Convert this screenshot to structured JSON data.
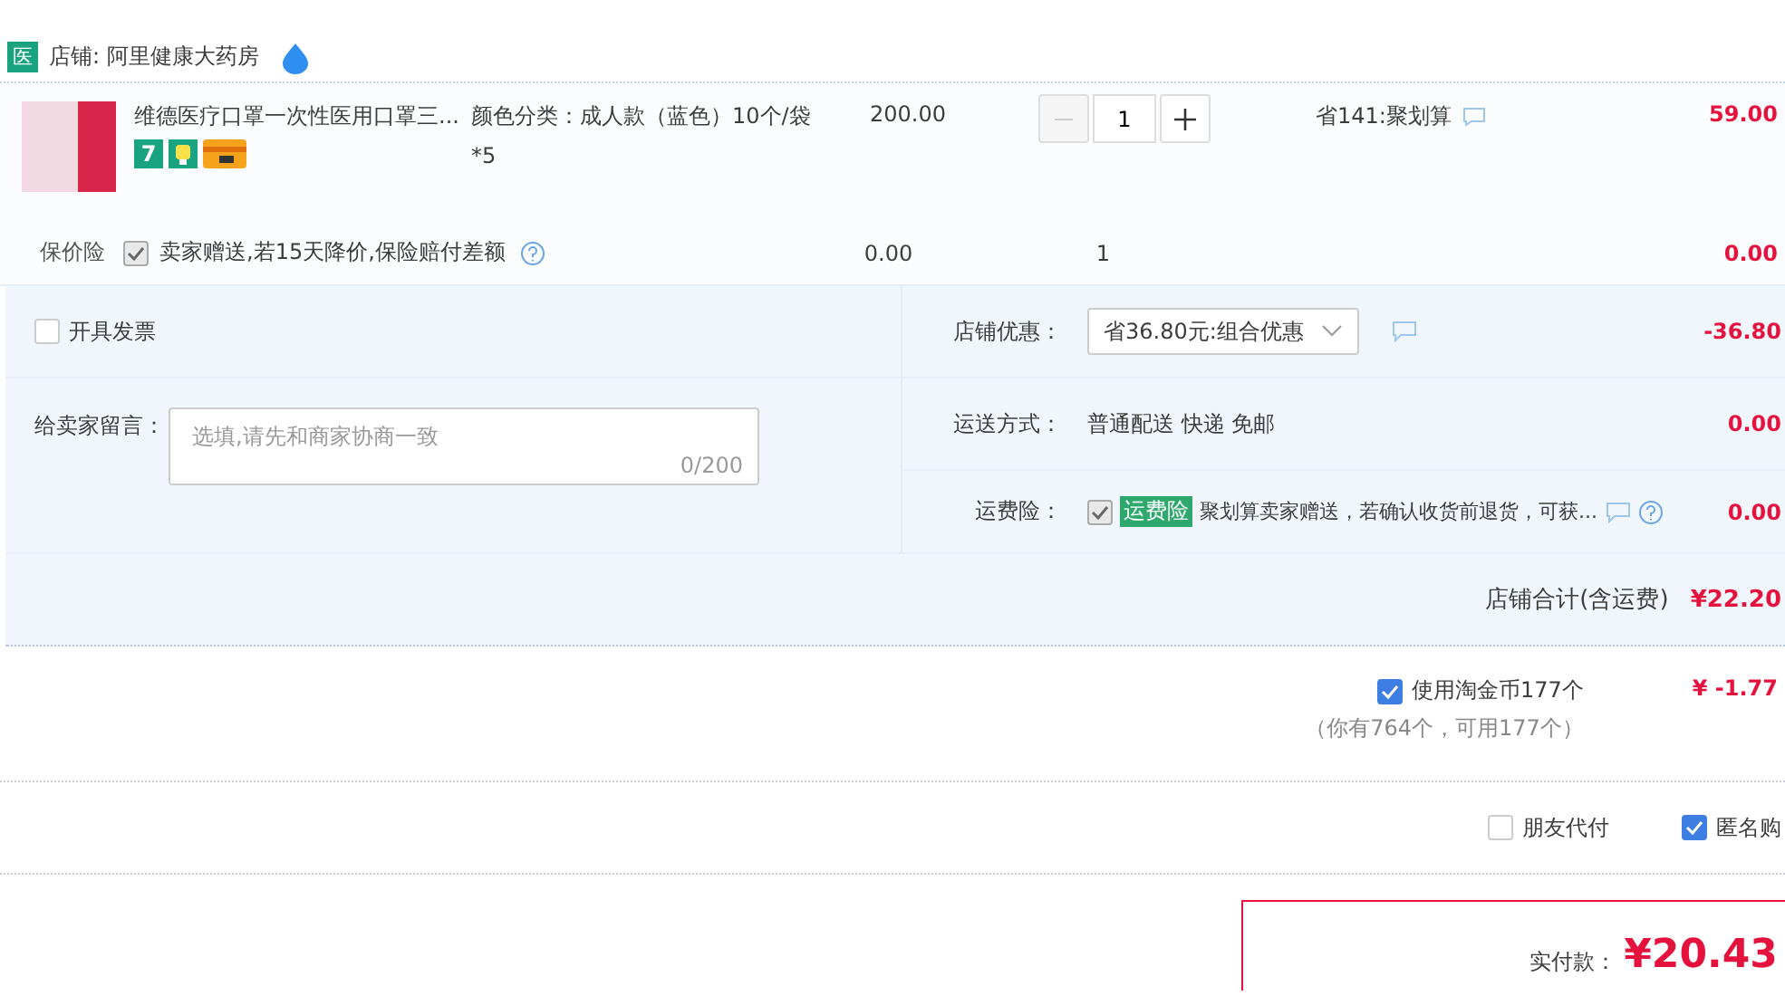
{
  "store": {
    "badge": "医",
    "name": "店铺: 阿里健康大药房"
  },
  "item": {
    "title": "维德医疗口罩一次性医用口罩三...",
    "service_badge": "7",
    "sku": "颜色分类：成人款（蓝色）10个/袋*5",
    "price": "200.00",
    "quantity": "1",
    "promo": "省141:聚划算",
    "subtotal": "59.00"
  },
  "protection": {
    "label": "保价险",
    "checked": true,
    "disabled": true,
    "text": "卖家赠送,若15天降价,保险赔付差额",
    "price": "0.00",
    "quantity": "1",
    "subtotal": "0.00"
  },
  "invoice": {
    "label": "开具发票",
    "checked": false
  },
  "message": {
    "label": "给卖家留言：",
    "placeholder": "选填,请先和商家协商一致",
    "counter": "0/200"
  },
  "summary": [
    {
      "kind": "select",
      "label": "店铺优惠：",
      "value": "省36.80元:组合优惠",
      "amount": "-36.80"
    },
    {
      "kind": "text",
      "label": "运送方式：",
      "value": "普通配送 快递 免邮",
      "amount": "0.00"
    },
    {
      "kind": "insurance",
      "label": "运费险：",
      "checked": true,
      "disabled": true,
      "tag": "运费险",
      "value": "聚划算卖家赠送，若确认收货前退货，可获...",
      "amount": "0.00"
    }
  ],
  "store_total": {
    "label": "店铺合计(含运费)",
    "amount": "¥22.20"
  },
  "coins": {
    "label": "使用淘金币177个",
    "checked": true,
    "note": "（你有764个，可用177个）",
    "amount": "¥ -1.77"
  },
  "options": [
    {
      "label": "朋友代付",
      "checked": false
    },
    {
      "label": "匿名购",
      "checked": true
    }
  ],
  "payment": {
    "label": "实付款：",
    "amount": "¥20.43"
  }
}
